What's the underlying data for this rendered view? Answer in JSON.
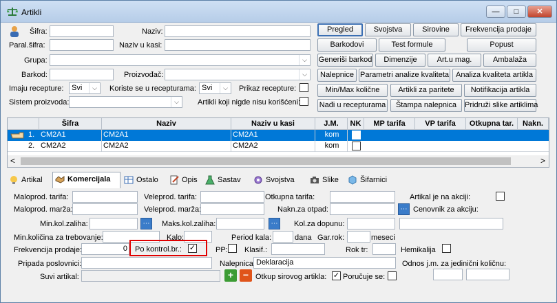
{
  "window": {
    "title": "Artikli",
    "minimize": "—",
    "maximize": "□",
    "close": "✕"
  },
  "filters": {
    "sifra_label": "Šifra:",
    "sifra_value": "",
    "naziv_label": "Naziv:",
    "naziv_value": "",
    "paral_sifra_label": "Paral.šifra:",
    "paral_sifra_value": "",
    "naziv_u_kasi_label": "Naziv u kasi:",
    "naziv_u_kasi_value": "",
    "grupa_label": "Grupa:",
    "grupa_value": "",
    "barkod_label": "Barkod:",
    "barkod_value": "",
    "proizvodjac_label": "Proizvođač:",
    "proizvodjac_value": "",
    "imaju_recepture_label": "Imaju recepture:",
    "imaju_recepture_value": "Svi",
    "koriste_label": "Koriste se u recepturama:",
    "koriste_value": "Svi",
    "prikaz_recepture_label": "Prikaz recepture:",
    "sistem_label": "Sistem proizvoda:",
    "sistem_value": "",
    "nigde_label": "Artikli koji nigde nisu korišćeni:"
  },
  "actions": [
    [
      "Pregled",
      "Svojstva",
      "Sirovine",
      "Frekvencija prodaje"
    ],
    [
      "Barkodovi",
      "Test formule",
      "Popust"
    ],
    [
      "Generiši barkod",
      "Dimenzije",
      "Art.u mag.",
      "Ambalaža"
    ],
    [
      "Nalepnice",
      "Parametri analize kvaliteta",
      "Analiza kvaliteta artikla"
    ],
    [
      "Min/Max količne",
      "Artikli za paritete",
      "Notifikacija artikla"
    ],
    [
      "Nađi u recepturama",
      "Štampa nalepnica",
      "Pridruži slike artiklima"
    ]
  ],
  "grid": {
    "columns": [
      "Šifra",
      "Naziv",
      "Naziv u kasi",
      "J.M.",
      "NK",
      "MP tarifa",
      "VP tarifa",
      "Otkupna tar.",
      "Nakn."
    ],
    "rows": [
      {
        "num": "1.",
        "sifra": "CM2A1",
        "naziv": "CM2A1",
        "naziv_kasa": "CM2A1",
        "jm": "kom"
      },
      {
        "num": "2.",
        "sifra": "CM2A2",
        "naziv": "CM2A2",
        "naziv_kasa": "CM2A2",
        "jm": "kom"
      }
    ],
    "scroll_left": "<",
    "scroll_right": ">"
  },
  "tabs": [
    "Artikal",
    "Komercijala",
    "Ostalo",
    "Opis",
    "Sastav",
    "Svojstva",
    "Slike",
    "Šifarnici"
  ],
  "komercijala": {
    "maloprod_tarifa": "Maloprod. tarifa:",
    "veleprod_tarifa": "Veleprod. tarifa:",
    "otkupna_tarifa": "Otkupna tarifa:",
    "artikal_akcija": "Artikal je na akciji:",
    "maloprod_marza": "Maloprod. marža:",
    "veleprod_marza": "Veleprod. marža:",
    "nakn_otpad": "Nakn.za otpad:",
    "cenovnik_akcija": "Cenovnik za akciju:",
    "min_zaliha": "Min.kol.zaliha:",
    "maks_zaliha": "Maks.kol.zaliha:",
    "kol_dopunu": "Kol.za dopunu:",
    "min_trebovanje": "Min.količina za trebovanje:",
    "kalo": "Kalo:",
    "period_kala": "Period kala:",
    "dana": "dana",
    "gar_rok": "Gar.rok:",
    "meseci": "meseci",
    "frekvencija": "Frekvencija prodaje:",
    "frekvencija_value": "0",
    "po_kontrol": "Po kontrol.br.:",
    "pp": "PP:",
    "klasif": "Klasif.:",
    "rok_tr": "Rok tr:",
    "hemikalija": "Hemikalija",
    "pripada": "Pripada poslovnici:",
    "nalepnica": "Nalepnica:",
    "nalepnica_value": "Deklaracija",
    "odnos": "Odnos j.m. za jedinični količnu:",
    "suvi": "Suvi artikal:",
    "otkup_sirovog": "Otkup sirovog artikla:",
    "poruce_se": "Poručuje se:",
    "add": "+",
    "remove": "−"
  },
  "colors": {
    "selection": "#0078d7",
    "highlight_border": "#e00000",
    "add_green": "#3c9c34",
    "remove_orange": "#e0541a"
  }
}
